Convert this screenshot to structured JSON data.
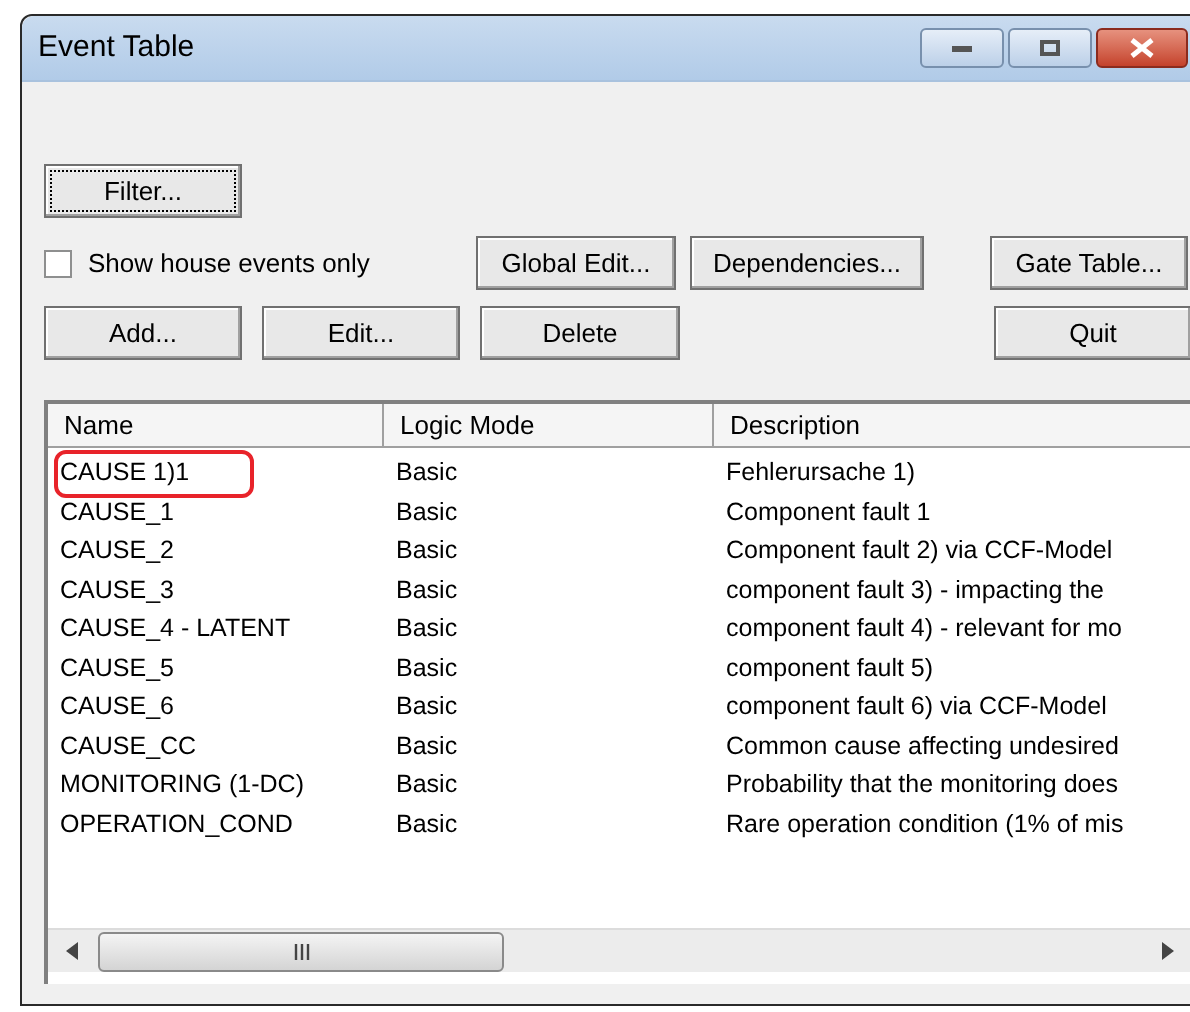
{
  "window": {
    "title": "Event Table"
  },
  "filter_button": "Filter...",
  "show_house_events_only": {
    "label": "Show house events only",
    "checked": false
  },
  "buttons_row1": [
    "Global Edit...",
    "Dependencies...",
    "Gate Table..."
  ],
  "buttons_row2": [
    "Add...",
    "Edit...",
    "Delete",
    "Quit"
  ],
  "table": {
    "columns": [
      "Name",
      "Logic Mode",
      "Description"
    ],
    "rows": [
      {
        "cells": [
          "CAUSE 1)1",
          "Basic",
          "Fehlerursache 1)"
        ],
        "highlighted": true
      },
      {
        "cells": [
          "CAUSE_1",
          "Basic",
          "Component fault 1"
        ],
        "highlighted": false
      },
      {
        "cells": [
          "CAUSE_2",
          "Basic",
          "Component fault 2) via CCF-Model"
        ],
        "highlighted": false
      },
      {
        "cells": [
          "CAUSE_3",
          "Basic",
          "component fault 3) - impacting the"
        ],
        "highlighted": false
      },
      {
        "cells": [
          "CAUSE_4 - LATENT",
          "Basic",
          "component fault 4) - relevant for mo"
        ],
        "highlighted": false
      },
      {
        "cells": [
          "CAUSE_5",
          "Basic",
          "component fault 5)"
        ],
        "highlighted": false
      },
      {
        "cells": [
          "CAUSE_6",
          "Basic",
          "component fault 6) via CCF-Model"
        ],
        "highlighted": false
      },
      {
        "cells": [
          "CAUSE_CC",
          "Basic",
          "Common cause affecting undesired"
        ],
        "highlighted": false
      },
      {
        "cells": [
          "MONITORING (1-DC)",
          "Basic",
          "Probability that the monitoring does"
        ],
        "highlighted": false
      },
      {
        "cells": [
          "OPERATION_COND",
          "Basic",
          "Rare operation condition (1% of mis"
        ],
        "highlighted": false
      }
    ]
  }
}
